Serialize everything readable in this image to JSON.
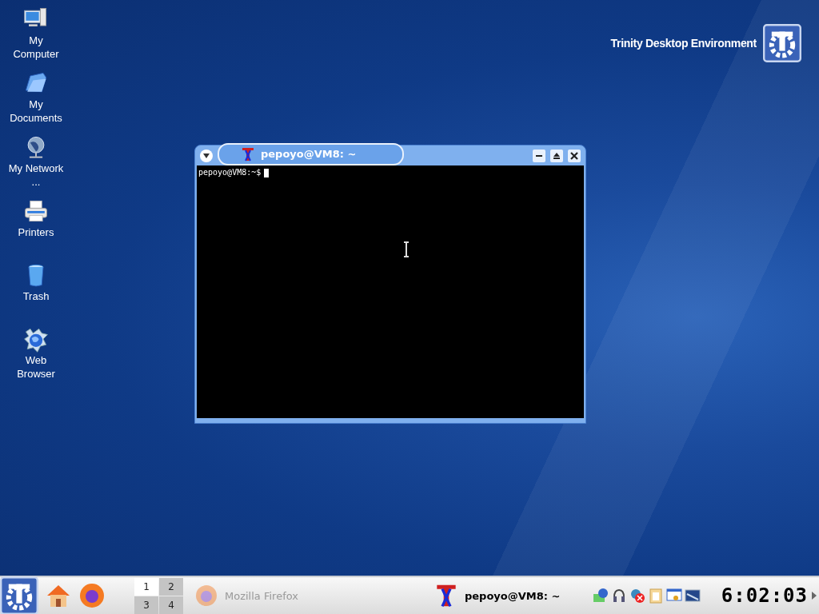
{
  "desktop_icons": [
    {
      "label": "My Computer",
      "kind": "computer"
    },
    {
      "label": "My Documents",
      "kind": "folder"
    },
    {
      "label": "My Network ...",
      "kind": "network"
    },
    {
      "label": "Printers",
      "kind": "printer"
    },
    {
      "label": "Trash",
      "kind": "trash"
    },
    {
      "label": "Web Browser",
      "kind": "browser"
    }
  ],
  "brand": {
    "text": "Trinity Desktop Environment"
  },
  "window": {
    "title": "pepoyo@VM8: ~",
    "prompt": "pepoyo@VM8:~$"
  },
  "taskbar": {
    "desktops": [
      {
        "label": "1",
        "selected": true
      },
      {
        "label": "2",
        "selected": false
      },
      {
        "label": "3",
        "selected": false
      },
      {
        "label": "4",
        "selected": false
      }
    ],
    "tasks": [
      {
        "label": "Mozilla Firefox",
        "kind": "firefox",
        "selected": false
      },
      {
        "label": "pepoyo@VM8: ~",
        "kind": "terminal",
        "selected": true
      }
    ],
    "clock": "6:02:03"
  }
}
